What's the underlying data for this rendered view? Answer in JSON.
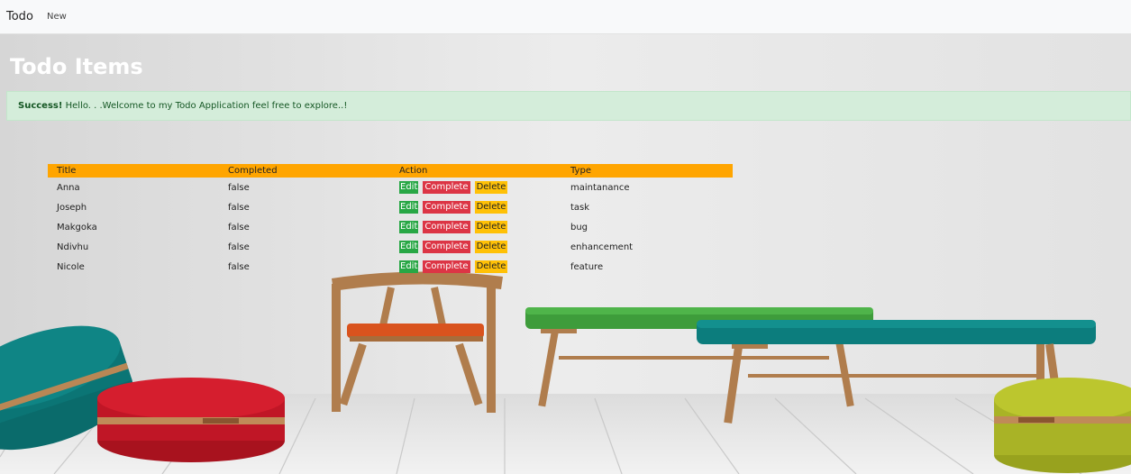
{
  "navbar": {
    "brand": "Todo",
    "new_link": "New"
  },
  "page": {
    "title": "Todo Items"
  },
  "alert": {
    "strong": "Success!",
    "message": " Hello. . .Welcome to my Todo Application feel free to explore..!"
  },
  "table": {
    "headers": {
      "title": "Title",
      "completed": "Completed",
      "action": "Action",
      "type": "Type"
    },
    "buttons": {
      "edit": "Edit",
      "complete": "Complete",
      "delete": "Delete"
    },
    "rows": [
      {
        "title": "Anna",
        "completed": "false",
        "type": "maintanance"
      },
      {
        "title": "Joseph",
        "completed": "false",
        "type": "task"
      },
      {
        "title": "Makgoka",
        "completed": "false",
        "type": "bug"
      },
      {
        "title": "Ndivhu",
        "completed": "false",
        "type": "enhancement"
      },
      {
        "title": "Nicole",
        "completed": "false",
        "type": "feature"
      }
    ]
  },
  "colors": {
    "header_bg": "#ffa500",
    "edit": "#28a745",
    "complete": "#dc3545",
    "delete": "#ffc107",
    "alert_bg": "#d4edda"
  }
}
